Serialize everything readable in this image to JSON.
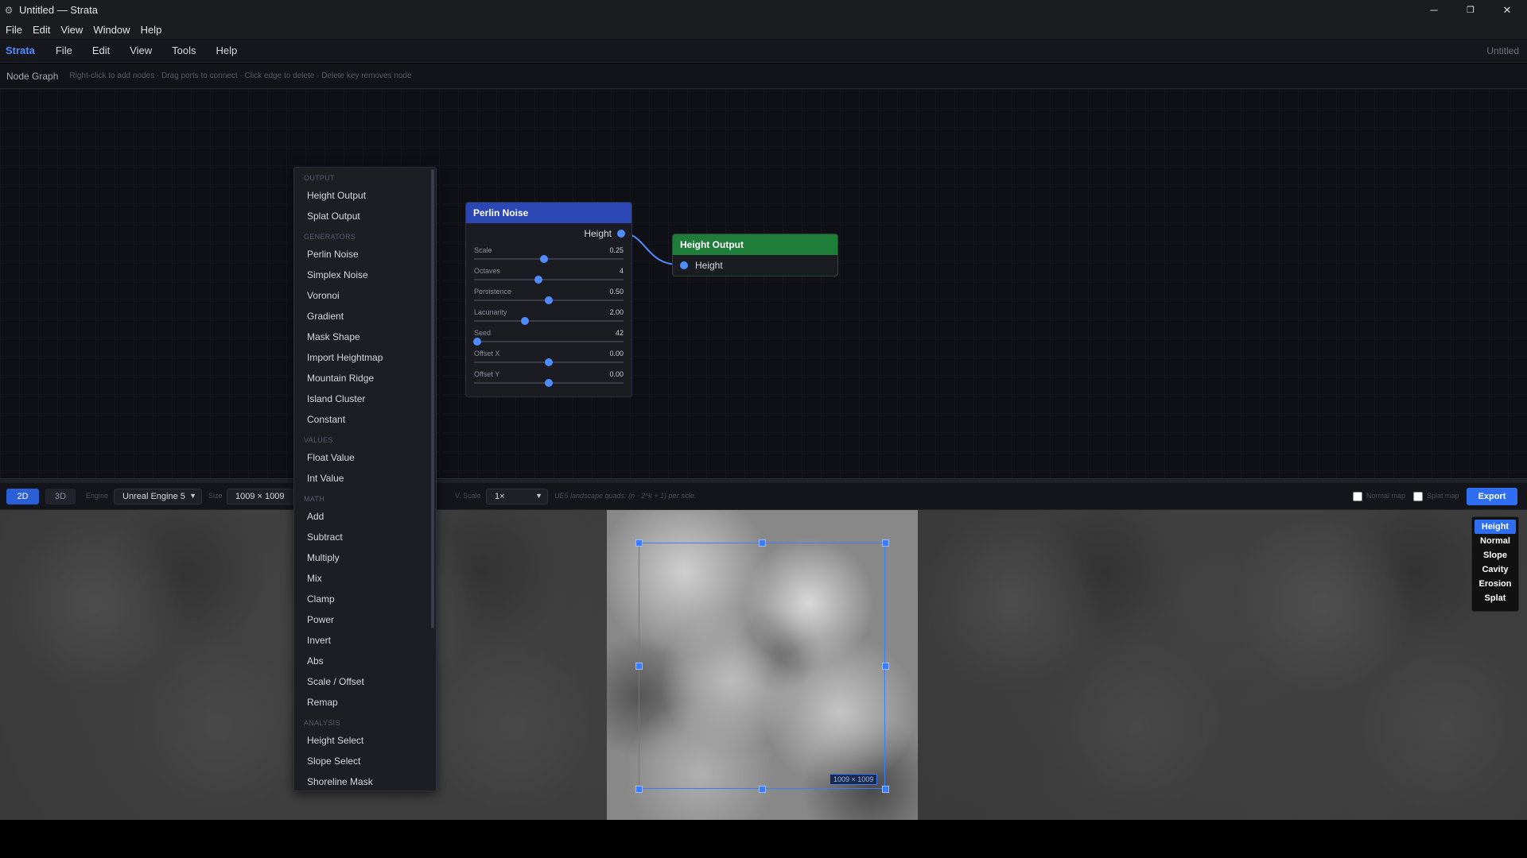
{
  "window": {
    "title": "Untitled — Strata",
    "controls": {
      "minimize": "─",
      "restore": "❐",
      "close": "✕"
    }
  },
  "native_menu": [
    "File",
    "Edit",
    "View",
    "Window",
    "Help"
  ],
  "app_menu": {
    "brand": "Strata",
    "items": [
      "File",
      "Edit",
      "View",
      "Tools",
      "Help"
    ],
    "document": "Untitled"
  },
  "graph_header": {
    "title": "Node Graph",
    "hint": "Right-click to add nodes · Drag ports to connect · Click edge to delete · Delete key removes node"
  },
  "nodes": {
    "perlin": {
      "title": "Perlin Noise",
      "output": "Height",
      "params": [
        {
          "label": "Scale",
          "value": "0.25",
          "fraction": 0.47
        },
        {
          "label": "Octaves",
          "value": "4",
          "fraction": 0.43
        },
        {
          "label": "Persistence",
          "value": "0.50",
          "fraction": 0.5
        },
        {
          "label": "Lacunarity",
          "value": "2.00",
          "fraction": 0.34
        },
        {
          "label": "Seed",
          "value": "42",
          "fraction": 0.02
        },
        {
          "label": "Offset X",
          "value": "0.00",
          "fraction": 0.5
        },
        {
          "label": "Offset Y",
          "value": "0.00",
          "fraction": 0.5
        }
      ]
    },
    "height_output": {
      "title": "Height Output",
      "input": "Height"
    }
  },
  "toolbar": {
    "mode_2d": "2D",
    "mode_3d": "3D",
    "engine_label": "Engine",
    "engine_value": "Unreal Engine 5",
    "size_label": "Size",
    "size_value": "1009 × 1009",
    "vscale_label": "V. Scale",
    "vscale_value": "1×",
    "note": "UE5 landscape quads: (n · 2^k + 1) per side.",
    "normal_map": "Normal map",
    "splat_map": "Splat map",
    "export": "Export"
  },
  "viewport": {
    "size_tag": "1009 × 1009",
    "layers": [
      {
        "label": "Height",
        "active": true
      },
      {
        "label": "Normal",
        "active": false
      },
      {
        "label": "Slope",
        "active": false
      },
      {
        "label": "Cavity",
        "active": false
      },
      {
        "label": "Erosion",
        "active": false
      },
      {
        "label": "Splat",
        "active": false
      }
    ]
  },
  "context_menu": [
    {
      "section": "OUTPUT",
      "items": [
        "Height Output",
        "Splat Output"
      ]
    },
    {
      "section": "GENERATORS",
      "items": [
        "Perlin Noise",
        "Simplex Noise",
        "Voronoi",
        "Gradient",
        "Mask Shape",
        "Import Heightmap",
        "Mountain Ridge",
        "Island Cluster",
        "Constant"
      ]
    },
    {
      "section": "VALUES",
      "items": [
        "Float Value",
        "Int Value"
      ]
    },
    {
      "section": "MATH",
      "items": [
        "Add",
        "Subtract",
        "Multiply",
        "Mix",
        "Clamp",
        "Power",
        "Invert",
        "Abs",
        "Scale / Offset",
        "Remap"
      ]
    },
    {
      "section": "ANALYSIS",
      "items": [
        "Height Select",
        "Slope Select",
        "Shoreline Mask"
      ]
    }
  ]
}
